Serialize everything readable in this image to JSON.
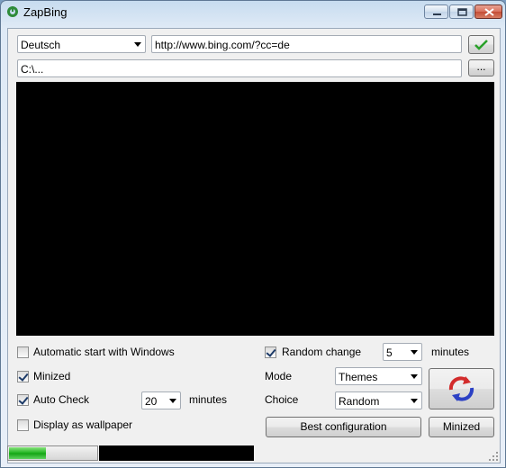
{
  "window": {
    "title": "ZapBing"
  },
  "language": {
    "selected": "Deutsch"
  },
  "url": {
    "value": "http://www.bing.com/?cc=de"
  },
  "folder": {
    "value": "C:\\...",
    "browse_label": "..."
  },
  "options": {
    "autostart": {
      "label": "Automatic start with Windows",
      "checked": false
    },
    "minimized": {
      "label": "Minized",
      "checked": true
    },
    "autocheck": {
      "label": "Auto Check",
      "checked": true,
      "value": "20",
      "unit": "minutes"
    },
    "wallpaper": {
      "label": "Display as wallpaper",
      "checked": false
    },
    "random_change": {
      "label": "Random change",
      "checked": true,
      "value": "5",
      "unit": "minutes"
    },
    "mode": {
      "label": "Mode",
      "value": "Themes"
    },
    "choice": {
      "label": "Choice",
      "value": "Random"
    }
  },
  "buttons": {
    "best_config": "Best configuration",
    "minimized": "Minized"
  },
  "progress": {
    "fraction": 0.42
  },
  "colors": {
    "preview": "#000000",
    "progress_fill": "#1db21d"
  },
  "icons": {
    "app": "zapbing-logo-icon",
    "ok": "green-checkmark-icon",
    "refresh": "refresh-arrows-icon"
  }
}
